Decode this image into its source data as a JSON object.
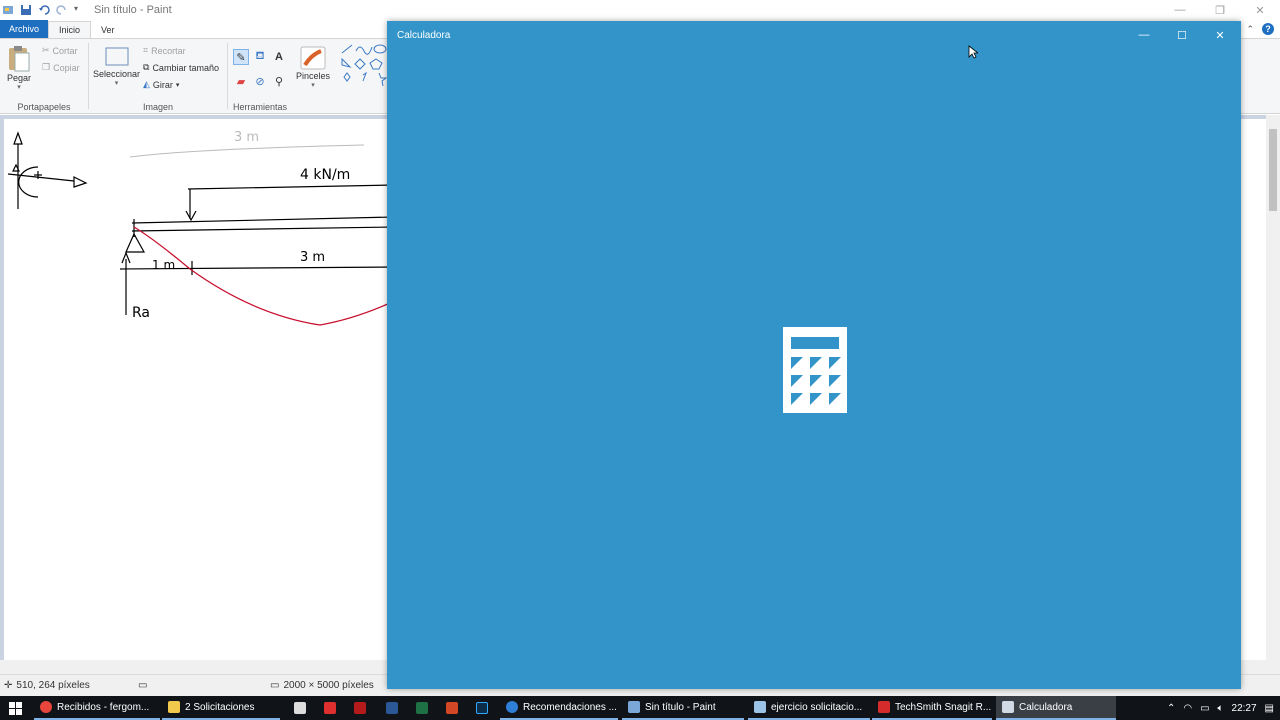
{
  "paint": {
    "title": "Sin título - Paint",
    "tabs": {
      "file": "Archivo",
      "home": "Inicio",
      "view": "Ver"
    },
    "clipboard": {
      "paste": "Pegar",
      "cut": "Cortar",
      "copy": "Copiar",
      "label": "Portapapeles"
    },
    "image": {
      "select": "Seleccionar",
      "crop": "Recortar",
      "resize": "Cambiar tamaño",
      "rotate": "Girar",
      "label": "Imagen"
    },
    "tools": {
      "label": "Herramientas"
    },
    "brushes": {
      "label": "Pinceles"
    },
    "status": {
      "cursor_position": "510, 264 píxeles",
      "canvas_size": "2000 × 5000 píxeles"
    },
    "drawing": {
      "dim_top": "3 m",
      "load": "4 kN/m",
      "dim_bottom": "3 m",
      "dim_small": "1 m",
      "reaction": "Ra",
      "load_color": "#000000",
      "curve_color": "#c8102e"
    }
  },
  "calculator": {
    "title": "Calculadora",
    "background": "#3294c9"
  },
  "taskbar": {
    "items": [
      {
        "label": "Recibidos - fergom...",
        "icon": "chrome-icon"
      },
      {
        "label": "2 Solicitaciones",
        "icon": "folder-icon"
      },
      {
        "label": "Recomendaciones ...",
        "icon": "edge-icon"
      },
      {
        "label": "Sin título - Paint",
        "icon": "paint-icon"
      },
      {
        "label": "ejercicio solicitacio...",
        "icon": "photos-icon"
      },
      {
        "label": "TechSmith Snagit R...",
        "icon": "snagit-icon"
      },
      {
        "label": "Calculadora",
        "icon": "calculator-icon"
      }
    ],
    "clock": "22:27"
  }
}
